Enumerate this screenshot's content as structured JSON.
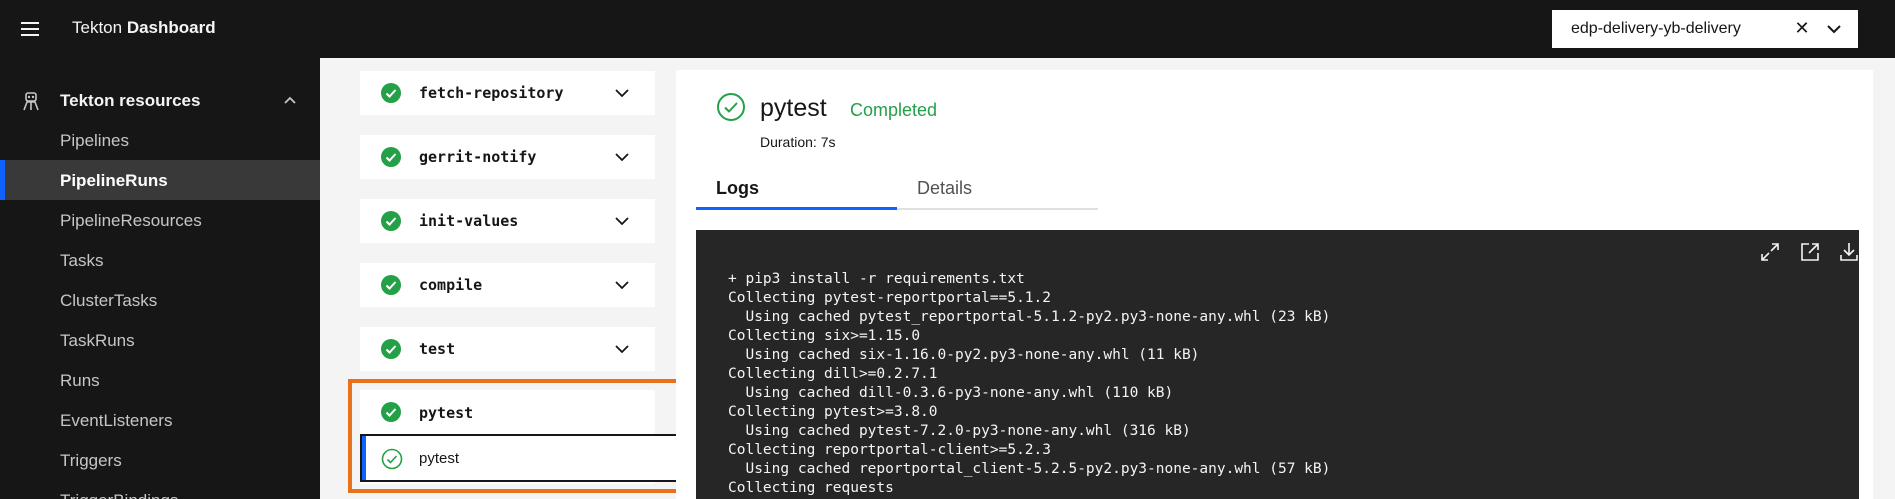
{
  "header": {
    "app_title_prefix": "Tekton",
    "app_title_bold": "Dashboard",
    "namespace_value": "edp-delivery-yb-delivery",
    "clear_symbol": "✕"
  },
  "sidebar": {
    "section_label": "Tekton resources",
    "items": [
      {
        "label": "Pipelines"
      },
      {
        "label": "PipelineRuns"
      },
      {
        "label": "PipelineResources"
      },
      {
        "label": "Tasks"
      },
      {
        "label": "ClusterTasks"
      },
      {
        "label": "TaskRuns"
      },
      {
        "label": "Runs"
      },
      {
        "label": "EventListeners"
      },
      {
        "label": "Triggers"
      },
      {
        "label": "TriggerBindings"
      }
    ],
    "active_item": "PipelineRuns"
  },
  "tasks": [
    {
      "label": "fetch-repository"
    },
    {
      "label": "gerrit-notify"
    },
    {
      "label": "init-values"
    },
    {
      "label": "compile"
    },
    {
      "label": "test"
    },
    {
      "label": "pytest"
    }
  ],
  "selected_step": {
    "label": "pytest"
  },
  "panel": {
    "title": "pytest",
    "status": "Completed",
    "duration": "Duration: 7s",
    "tabs": [
      {
        "label": "Logs"
      },
      {
        "label": "Details"
      }
    ],
    "active_tab": "Logs"
  },
  "log": {
    "lines": [
      "+ pip3 install -r requirements.txt",
      "Collecting pytest-reportportal==5.1.2",
      "  Using cached pytest_reportportal-5.1.2-py2.py3-none-any.whl (23 kB)",
      "Collecting six>=1.15.0",
      "  Using cached six-1.16.0-py2.py3-none-any.whl (11 kB)",
      "Collecting dill>=0.2.7.1",
      "  Using cached dill-0.3.6-py3-none-any.whl (110 kB)",
      "Collecting pytest>=3.8.0",
      "  Using cached pytest-7.2.0-py3-none-any.whl (316 kB)",
      "Collecting reportportal-client>=5.2.3",
      "  Using cached reportportal_client-5.2.5-py2.py3-none-any.whl (57 kB)",
      "Collecting requests"
    ]
  },
  "icons": {
    "menu": "hamburger-menu-icon",
    "namespace_chevron": "chevron-down-icon",
    "section": "tekton-robot-icon",
    "section_chevron": "chevron-up-icon",
    "task_status": "checkmark-filled-icon",
    "step_status": "checkmark-outline-icon",
    "maximize": "maximize-icon",
    "launch": "launch-icon",
    "download": "download-icon"
  },
  "colors": {
    "header_bg": "#161616",
    "sidebar_bg": "#161616",
    "active_accent": "#0f62fe",
    "success": "#24a148",
    "highlight_outline": "#e8711c",
    "log_bg": "#262626"
  }
}
